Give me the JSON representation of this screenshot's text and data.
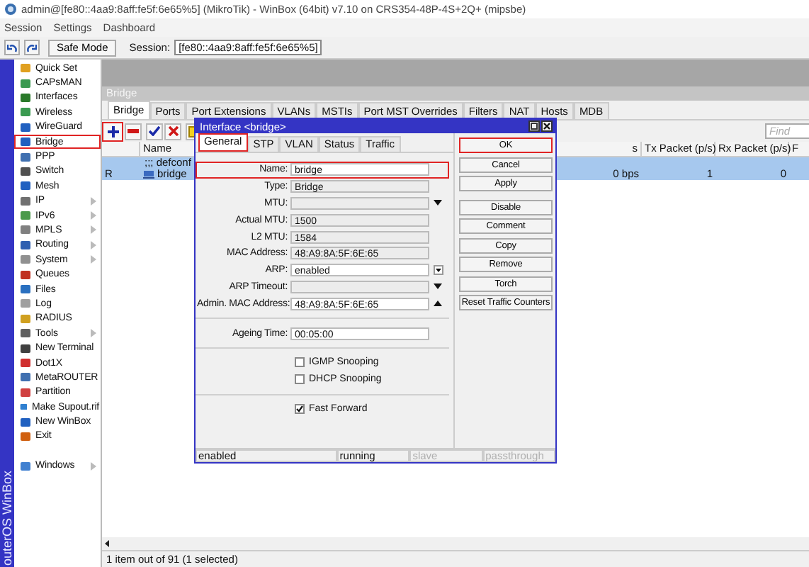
{
  "window": {
    "title": "admin@[fe80::4aa9:8aff:fe5f:6e65%5] (MikroTik) - WinBox (64bit) v7.10 on CRS354-48P-4S+2Q+ (mipsbe)"
  },
  "menu": [
    "Session",
    "Settings",
    "Dashboard"
  ],
  "toolbar": {
    "safe_mode": "Safe Mode",
    "session_label": "Session:",
    "session_value": "[fe80::4aa9:8aff:fe5f:6e65%5]"
  },
  "side_banner": "outerOS WinBox",
  "sidebar": {
    "items": [
      {
        "label": "Quick Set",
        "submenu": false,
        "highlighted": false
      },
      {
        "label": "CAPsMAN",
        "submenu": false,
        "highlighted": false
      },
      {
        "label": "Interfaces",
        "submenu": false,
        "highlighted": false
      },
      {
        "label": "Wireless",
        "submenu": false,
        "highlighted": false
      },
      {
        "label": "WireGuard",
        "submenu": false,
        "highlighted": false
      },
      {
        "label": "Bridge",
        "submenu": false,
        "highlighted": true
      },
      {
        "label": "PPP",
        "submenu": false,
        "highlighted": false
      },
      {
        "label": "Switch",
        "submenu": false,
        "highlighted": false
      },
      {
        "label": "Mesh",
        "submenu": false,
        "highlighted": false
      },
      {
        "label": "IP",
        "submenu": true,
        "highlighted": false
      },
      {
        "label": "IPv6",
        "submenu": true,
        "highlighted": false
      },
      {
        "label": "MPLS",
        "submenu": true,
        "highlighted": false
      },
      {
        "label": "Routing",
        "submenu": true,
        "highlighted": false
      },
      {
        "label": "System",
        "submenu": true,
        "highlighted": false
      },
      {
        "label": "Queues",
        "submenu": false,
        "highlighted": false
      },
      {
        "label": "Files",
        "submenu": false,
        "highlighted": false
      },
      {
        "label": "Log",
        "submenu": false,
        "highlighted": false
      },
      {
        "label": "RADIUS",
        "submenu": false,
        "highlighted": false
      },
      {
        "label": "Tools",
        "submenu": true,
        "highlighted": false
      },
      {
        "label": "New Terminal",
        "submenu": false,
        "highlighted": false
      },
      {
        "label": "Dot1X",
        "submenu": false,
        "highlighted": false
      },
      {
        "label": "MetaROUTER",
        "submenu": false,
        "highlighted": false
      },
      {
        "label": "Partition",
        "submenu": false,
        "highlighted": false
      },
      {
        "label": "Make Supout.rif",
        "submenu": false,
        "highlighted": false
      },
      {
        "label": "New WinBox",
        "submenu": false,
        "highlighted": false
      },
      {
        "label": "Exit",
        "submenu": false,
        "highlighted": false
      },
      {
        "label": "Windows",
        "submenu": true,
        "highlighted": false,
        "gap_before": true
      }
    ]
  },
  "bridge_window": {
    "title": "Bridge",
    "tabs": [
      {
        "label": "Bridge",
        "selected": true
      },
      {
        "label": "Ports",
        "selected": false
      },
      {
        "label": "Port Extensions",
        "selected": false
      },
      {
        "label": "VLANs",
        "selected": false
      },
      {
        "label": "MSTIs",
        "selected": false
      },
      {
        "label": "Port MST Overrides",
        "selected": false
      },
      {
        "label": "Filters",
        "selected": false
      },
      {
        "label": "NAT",
        "selected": false
      },
      {
        "label": "Hosts",
        "selected": false
      },
      {
        "label": "MDB",
        "selected": false
      }
    ],
    "toolbar": [
      {
        "kind": "add",
        "highlighted": true
      },
      {
        "kind": "remove",
        "highlighted": false
      },
      {
        "kind": "enable",
        "highlighted": false
      },
      {
        "kind": "disable",
        "highlighted": false
      },
      {
        "kind": "comment",
        "highlighted": false
      }
    ],
    "find": {
      "placeholder": "Find"
    },
    "table": {
      "columns": [
        {},
        {
          "label": "Name"
        },
        {
          "label": "s"
        },
        {
          "label": "Tx Packet (p/s)"
        },
        {
          "label": "Rx Packet (p/s)"
        },
        {
          "label": "F"
        }
      ],
      "rows": [
        {
          "kind": "comment",
          "text": ";;; defconf",
          "selected": true
        },
        {
          "kind": "item",
          "cells": [
            "R",
            "bridge",
            "0 bps",
            "1",
            "0"
          ],
          "selected": true
        }
      ]
    },
    "status_bar": "1 item out of 91 (1 selected)"
  },
  "dialog": {
    "title": "Interface <bridge>",
    "tabs": [
      {
        "label": "General",
        "selected": true,
        "highlighted": true
      },
      {
        "label": "STP",
        "selected": false,
        "highlighted": false
      },
      {
        "label": "VLAN",
        "selected": false,
        "highlighted": false
      },
      {
        "label": "Status",
        "selected": false,
        "highlighted": false
      },
      {
        "label": "Traffic",
        "selected": false,
        "highlighted": false
      }
    ],
    "groups": [
      [
        {
          "kind": "field",
          "label": "Name:",
          "value": "bridge",
          "readonly": false,
          "highlighted": true
        },
        {
          "kind": "field",
          "label": "Type:",
          "value": "Bridge",
          "readonly": true,
          "highlighted": false
        },
        {
          "kind": "field",
          "label": "MTU:",
          "readonly": true,
          "button": {
            "kind": "down"
          },
          "highlighted": false
        },
        {
          "kind": "field",
          "label": "Actual MTU:",
          "value": "1500",
          "readonly": true,
          "highlighted": false
        },
        {
          "kind": "field",
          "label": "L2 MTU:",
          "value": "1584",
          "readonly": true,
          "highlighted": false
        },
        {
          "kind": "field",
          "label": "MAC Address:",
          "value": "48:A9:8A:5F:6E:65",
          "readonly": true,
          "highlighted": false
        },
        {
          "kind": "field",
          "label": "ARP:",
          "value": "enabled",
          "readonly": false,
          "button": {
            "kind": "select"
          },
          "highlighted": false
        },
        {
          "kind": "field",
          "label": "ARP Timeout:",
          "readonly": true,
          "button": {
            "kind": "down"
          },
          "highlighted": false
        },
        {
          "kind": "field",
          "label": "Admin. MAC Address:",
          "value": "48:A9:8A:5F:6E:65",
          "readonly": false,
          "button": {
            "kind": "up"
          },
          "highlighted": false
        }
      ],
      [
        {
          "kind": "field",
          "label": "Ageing Time:",
          "value": "00:05:00",
          "readonly": false,
          "highlighted": false
        }
      ],
      [
        {
          "kind": "checkbox",
          "label": "IGMP Snooping",
          "checked": false
        },
        {
          "kind": "checkbox",
          "label": "DHCP Snooping",
          "checked": false
        }
      ],
      [
        {
          "kind": "checkbox",
          "label": "Fast Forward",
          "checked": true
        }
      ]
    ],
    "buttons": [
      {
        "label": "OK",
        "highlighted": true
      },
      {
        "label": "Cancel",
        "highlighted": false
      },
      {
        "label": "Apply",
        "highlighted": false
      },
      {
        "label": "Disable",
        "highlighted": false
      },
      {
        "label": "Comment",
        "highlighted": false
      },
      {
        "label": "Copy",
        "highlighted": false
      },
      {
        "label": "Remove",
        "highlighted": false
      },
      {
        "label": "Torch",
        "highlighted": false
      },
      {
        "label": "Reset Traffic Counters",
        "highlighted": false
      }
    ],
    "status_bar": [
      {
        "text": "enabled",
        "dimmed": false
      },
      {
        "text": "running",
        "dimmed": false
      },
      {
        "text": "slave",
        "dimmed": true
      },
      {
        "text": "passthrough",
        "dimmed": true
      }
    ]
  }
}
